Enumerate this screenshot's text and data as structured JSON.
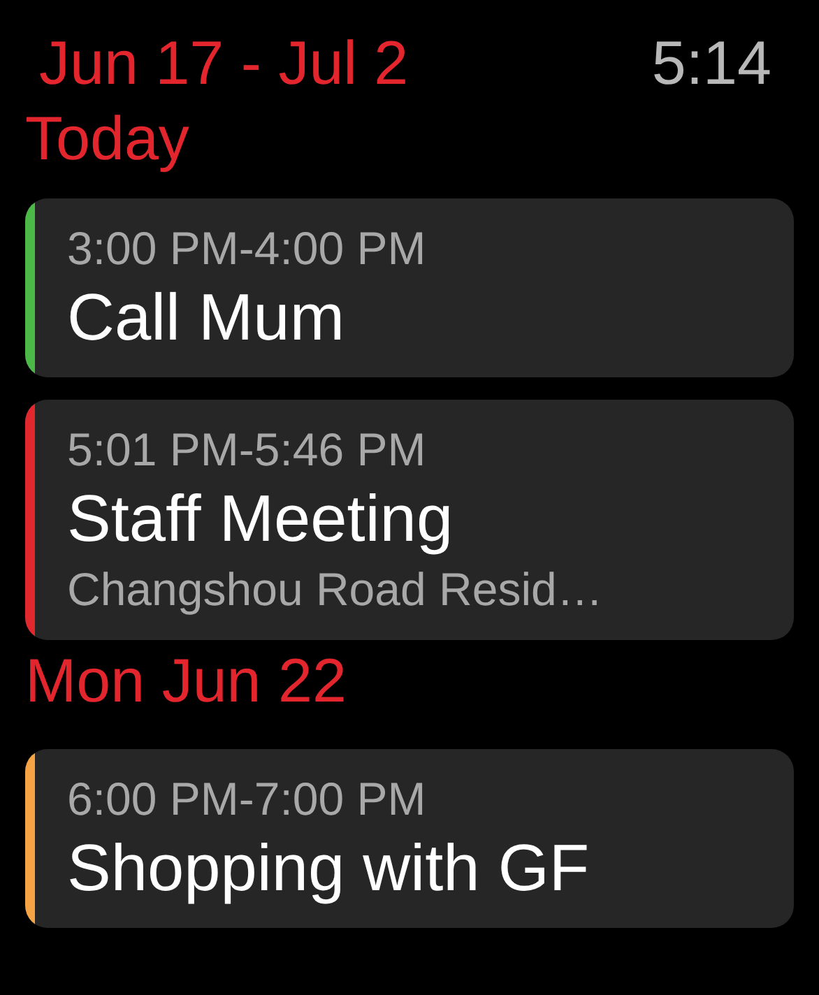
{
  "header": {
    "date_range": "Jun 17 - Jul 2",
    "time": "5:14"
  },
  "sections": [
    {
      "heading": "Today",
      "events": [
        {
          "time": "3:00 PM-4:00 PM",
          "title": "Call Mum",
          "color": "#4cb848"
        },
        {
          "time": "5:01 PM-5:46 PM",
          "title": "Staff Meeting",
          "location": "Changshou Road Resid…",
          "color": "#e0282e"
        }
      ]
    },
    {
      "heading": "Mon Jun 22",
      "events": [
        {
          "time": "6:00 PM-7:00 PM",
          "title": "Shopping with GF",
          "color": "#f5a345"
        }
      ]
    }
  ]
}
